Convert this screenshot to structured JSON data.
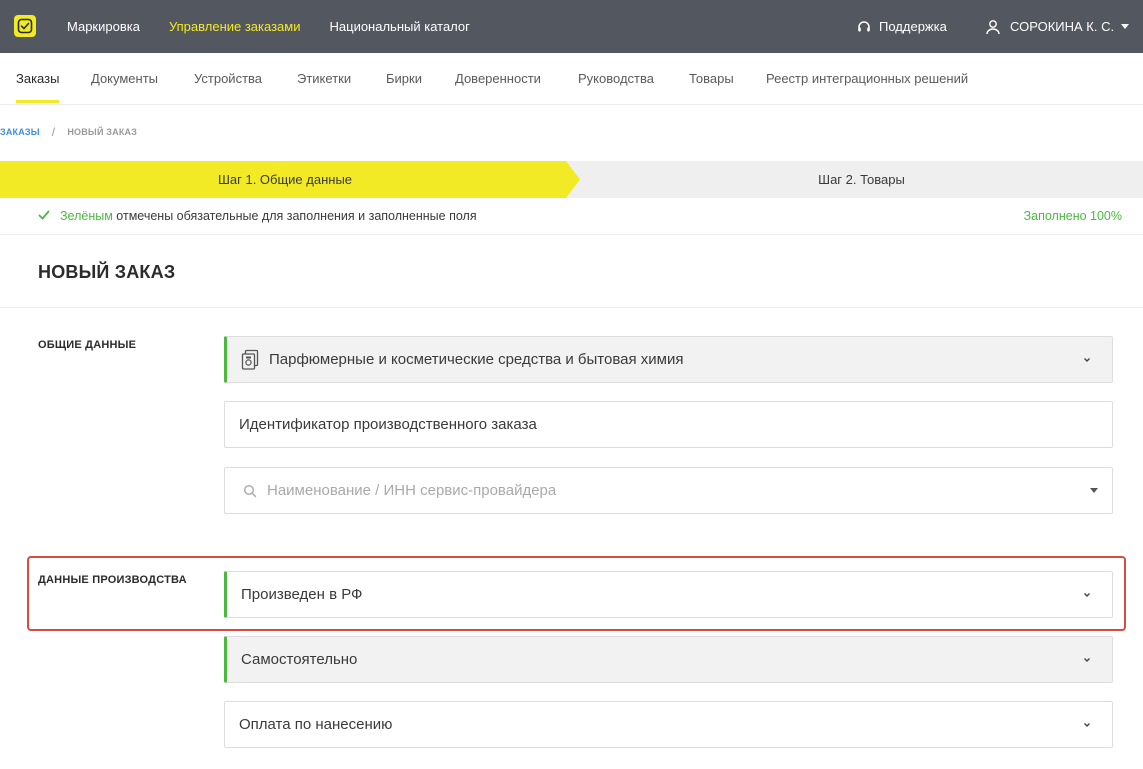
{
  "topbar": {
    "nav": [
      "Маркировка",
      "Управление заказами",
      "Национальный каталог"
    ],
    "active_index": 1,
    "support_label": "Поддержка",
    "user_name": "СОРОКИНА К. С.",
    "accent_color": "#f2ea25",
    "background_color": "#53575f"
  },
  "subnav": {
    "tabs": [
      "Заказы",
      "Документы",
      "Устройства",
      "Этикетки",
      "Бирки",
      "Доверенности",
      "Руководства",
      "Товары",
      "Реестр интеграционных решений"
    ],
    "active_index": 0
  },
  "breadcrumb": {
    "parent": "ЗАКАЗЫ",
    "separator": "/",
    "current": "НОВЫЙ ЗАКАЗ"
  },
  "steps": {
    "step1": "Шаг 1. Общие данные",
    "step2": "Шаг 2. Товары",
    "active_step": 1
  },
  "info": {
    "green_word": "Зелёным",
    "message_rest": " отмечены обязательные для заполнения и заполненные поля",
    "filled_percent": "Заполнено 100%",
    "success_color": "#4cb840"
  },
  "page_title": "НОВЫЙ ЗАКАЗ",
  "general": {
    "label": "ОБЩИЕ ДАННЫЕ",
    "product_group": "Парфюмерные и косметические средства и бытовая химия",
    "production_order_id_placeholder": "Идентификатор производственного заказа",
    "service_provider_placeholder": "Наименование / ИНН сервис-провайдера"
  },
  "production": {
    "label": "ДАННЫЕ ПРОИЗВОДСТВА",
    "origin": "Произведен в РФ",
    "release_method": "Самостоятельно",
    "payment_type": "Оплата по нанесению"
  }
}
